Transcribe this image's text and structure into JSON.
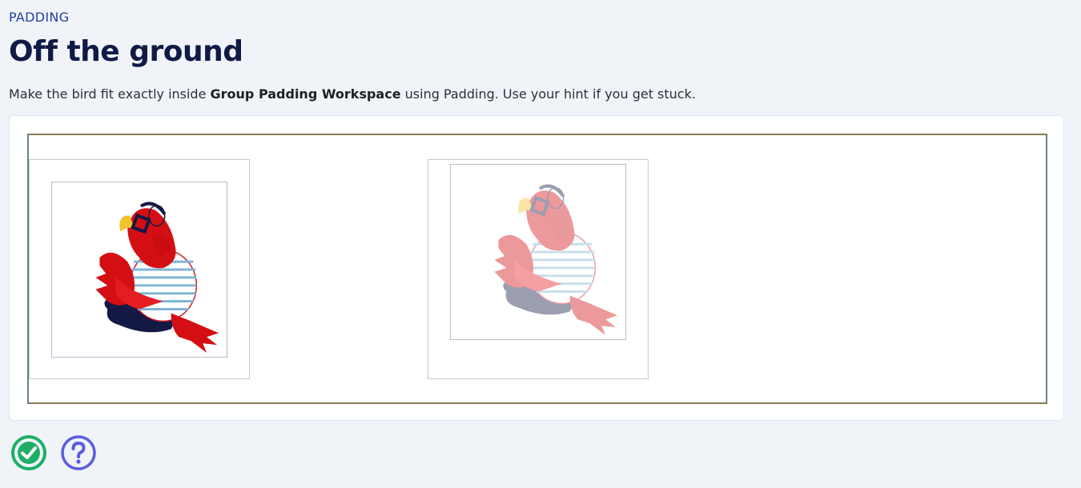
{
  "header": {
    "eyebrow": "PADDING",
    "title": "Off the ground",
    "description_pre": "Make the bird fit exactly inside ",
    "description_bold": "Group Padding Workspace",
    "description_post": " using Padding. Use your hint if you get stuck."
  },
  "workspace": {
    "user_group": {
      "bird": "parrot-icon"
    },
    "target_group": {
      "bird": "parrot-icon",
      "style": "ghost"
    }
  },
  "actions": {
    "check_icon": "check-circle-icon",
    "hint_icon": "help-circle-icon"
  },
  "colors": {
    "accent_green": "#1fae66",
    "accent_purple": "#5b5ce0",
    "title": "#101a45",
    "eyebrow": "#2a3d9c"
  }
}
